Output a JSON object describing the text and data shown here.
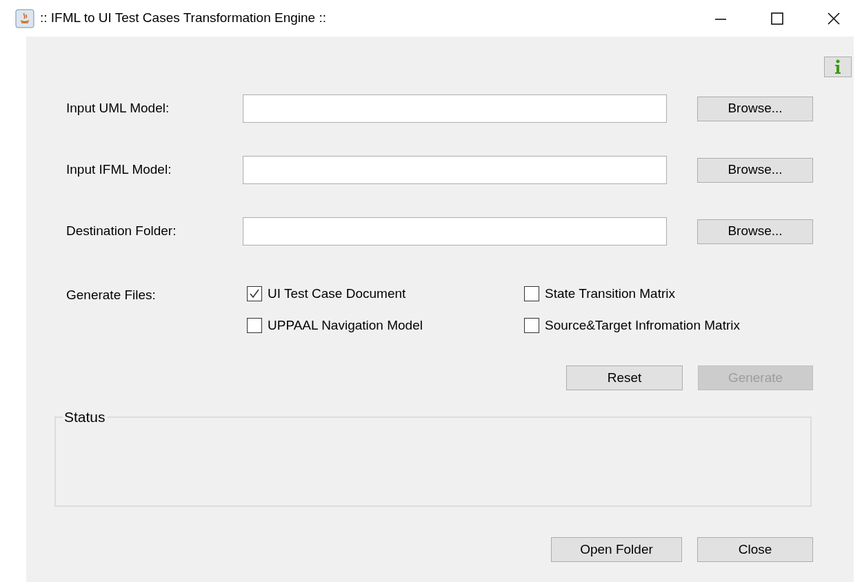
{
  "window": {
    "title": ":: IFML to UI Test Cases Transformation Engine ::"
  },
  "fields": [
    {
      "label": "Input UML Model:",
      "button": "Browse..."
    },
    {
      "label": "Input IFML Model:",
      "button": "Browse..."
    },
    {
      "label": "Destination Folder:",
      "button": "Browse..."
    }
  ],
  "generate_files": {
    "label": "Generate Files:",
    "options": [
      {
        "label": "UI Test Case Document",
        "checked": true
      },
      {
        "label": "State Transition Matrix",
        "checked": false
      },
      {
        "label": "UPPAAL Navigation Model",
        "checked": false
      },
      {
        "label": "Source&Target Infromation Matrix",
        "checked": false
      }
    ]
  },
  "actions": [
    {
      "label": "Reset",
      "disabled": false
    },
    {
      "label": "Generate",
      "disabled": true
    }
  ],
  "status": {
    "title": "Status"
  },
  "footer_buttons": [
    {
      "label": "Open Folder"
    },
    {
      "label": "Close"
    }
  ]
}
